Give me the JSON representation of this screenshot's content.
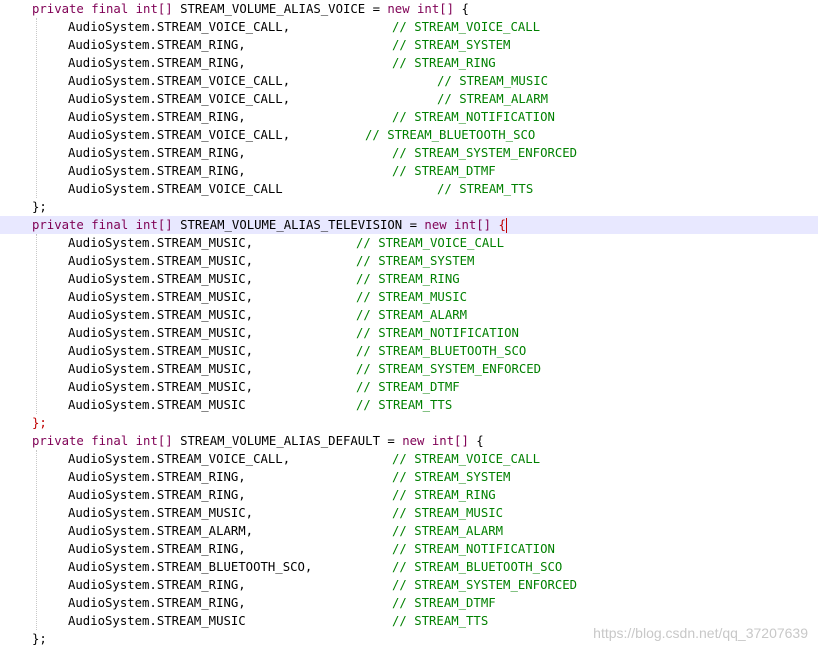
{
  "colors": {
    "keyword": "#7f0055",
    "type_keyword": "#0000c0",
    "comment": "#008000",
    "text": "#000000",
    "current_line": "#e8e8ff",
    "error_brace": "#c00000"
  },
  "blocks": [
    {
      "decl": {
        "modifiers": "private final",
        "type": "int[]",
        "name": "STREAM_VOLUME_ALIAS_VOICE",
        "assign": "=",
        "new_kw": "new",
        "new_type": "int[]",
        "open": "{"
      },
      "rows": [
        {
          "code": "AudioSystem.STREAM_VOICE_CALL,",
          "comment": "// STREAM_VOICE_CALL"
        },
        {
          "code": "AudioSystem.STREAM_RING,",
          "comment": "// STREAM_SYSTEM"
        },
        {
          "code": "AudioSystem.STREAM_RING,",
          "comment": "// STREAM_RING"
        },
        {
          "code": "AudioSystem.STREAM_VOICE_CALL,",
          "comment": "// STREAM_MUSIC"
        },
        {
          "code": "AudioSystem.STREAM_VOICE_CALL,",
          "comment": "// STREAM_ALARM"
        },
        {
          "code": "AudioSystem.STREAM_RING,",
          "comment": "// STREAM_NOTIFICATION"
        },
        {
          "code": "AudioSystem.STREAM_VOICE_CALL,",
          "comment": "// STREAM_BLUETOOTH_SCO"
        },
        {
          "code": "AudioSystem.STREAM_RING,",
          "comment": "// STREAM_SYSTEM_ENFORCED"
        },
        {
          "code": "AudioSystem.STREAM_RING,",
          "comment": "// STREAM_DTMF"
        },
        {
          "code": "AudioSystem.STREAM_VOICE_CALL",
          "comment": "// STREAM_TTS"
        }
      ],
      "close": "};"
    },
    {
      "decl": {
        "modifiers": "private final",
        "type": "int[]",
        "name": "STREAM_VOLUME_ALIAS_TELEVISION",
        "assign": "=",
        "new_kw": "new",
        "new_type": "int[]",
        "open": "{"
      },
      "rows": [
        {
          "code": "AudioSystem.STREAM_MUSIC,",
          "comment": "// STREAM_VOICE_CALL"
        },
        {
          "code": "AudioSystem.STREAM_MUSIC,",
          "comment": "// STREAM_SYSTEM"
        },
        {
          "code": "AudioSystem.STREAM_MUSIC,",
          "comment": "// STREAM_RING"
        },
        {
          "code": "AudioSystem.STREAM_MUSIC,",
          "comment": "// STREAM_MUSIC"
        },
        {
          "code": "AudioSystem.STREAM_MUSIC,",
          "comment": "// STREAM_ALARM"
        },
        {
          "code": "AudioSystem.STREAM_MUSIC,",
          "comment": "// STREAM_NOTIFICATION"
        },
        {
          "code": "AudioSystem.STREAM_MUSIC,",
          "comment": "// STREAM_BLUETOOTH_SCO"
        },
        {
          "code": "AudioSystem.STREAM_MUSIC,",
          "comment": "// STREAM_SYSTEM_ENFORCED"
        },
        {
          "code": "AudioSystem.STREAM_MUSIC,",
          "comment": "// STREAM_DTMF"
        },
        {
          "code": "AudioSystem.STREAM_MUSIC",
          "comment": "// STREAM_TTS"
        }
      ],
      "close": "};"
    },
    {
      "decl": {
        "modifiers": "private final",
        "type": "int[]",
        "name": "STREAM_VOLUME_ALIAS_DEFAULT",
        "assign": "=",
        "new_kw": "new",
        "new_type": "int[]",
        "open": "{"
      },
      "rows": [
        {
          "code": "AudioSystem.STREAM_VOICE_CALL,",
          "comment": "// STREAM_VOICE_CALL"
        },
        {
          "code": "AudioSystem.STREAM_RING,",
          "comment": "// STREAM_SYSTEM"
        },
        {
          "code": "AudioSystem.STREAM_RING,",
          "comment": "// STREAM_RING"
        },
        {
          "code": "AudioSystem.STREAM_MUSIC,",
          "comment": "// STREAM_MUSIC"
        },
        {
          "code": "AudioSystem.STREAM_ALARM,",
          "comment": "// STREAM_ALARM"
        },
        {
          "code": "AudioSystem.STREAM_RING,",
          "comment": "// STREAM_NOTIFICATION"
        },
        {
          "code": "AudioSystem.STREAM_BLUETOOTH_SCO,",
          "comment": "// STREAM_BLUETOOTH_SCO"
        },
        {
          "code": "AudioSystem.STREAM_RING,",
          "comment": "// STREAM_SYSTEM_ENFORCED"
        },
        {
          "code": "AudioSystem.STREAM_RING,",
          "comment": "// STREAM_DTMF"
        },
        {
          "code": "AudioSystem.STREAM_MUSIC",
          "comment": "// STREAM_TTS"
        }
      ],
      "close": "};"
    }
  ],
  "watermark": "https://blog.csdn.net/qq_37207639"
}
